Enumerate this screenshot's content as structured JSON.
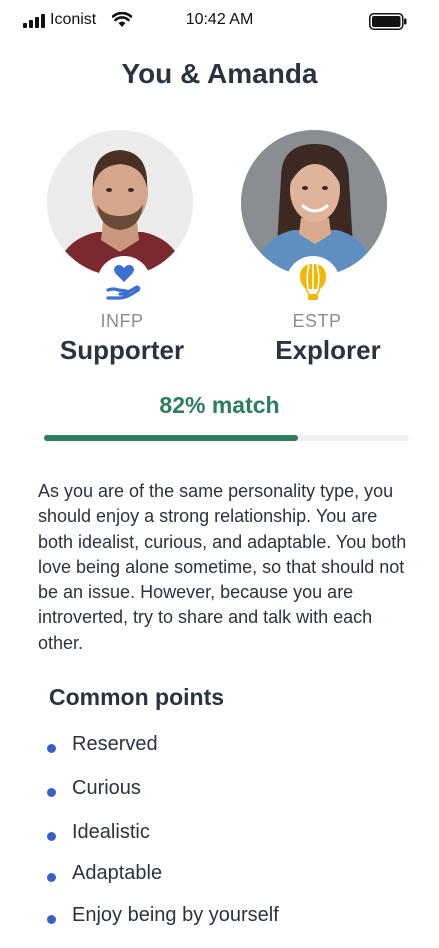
{
  "status_bar": {
    "carrier": "Iconist",
    "time": "10:42 AM"
  },
  "header": {
    "title": "You & Amanda"
  },
  "profiles": [
    {
      "person": "user",
      "type_code": "INFP",
      "type_name": "Supporter",
      "badge_icon": "heart-hand-icon",
      "badge_color": "#3b6fd1"
    },
    {
      "person": "Amanda",
      "type_code": "ESTP",
      "type_name": "Explorer",
      "badge_icon": "hot-air-balloon-icon",
      "badge_color": "#f2b705"
    }
  ],
  "match": {
    "label": "82% match",
    "percent": 82,
    "color": "#2e7d5b"
  },
  "description": "As you are of the same personality type, you should enjoy a strong relationship. You are both idealist, curious, and adaptable. You both love being alone sometime, so that should not be an issue. However, because you are introverted, try to share and talk with each other.",
  "common_points": {
    "title": "Common points",
    "items": [
      "Reserved",
      "Curious",
      "Idealistic",
      "Adaptable",
      "Enjoy being by yourself"
    ]
  }
}
